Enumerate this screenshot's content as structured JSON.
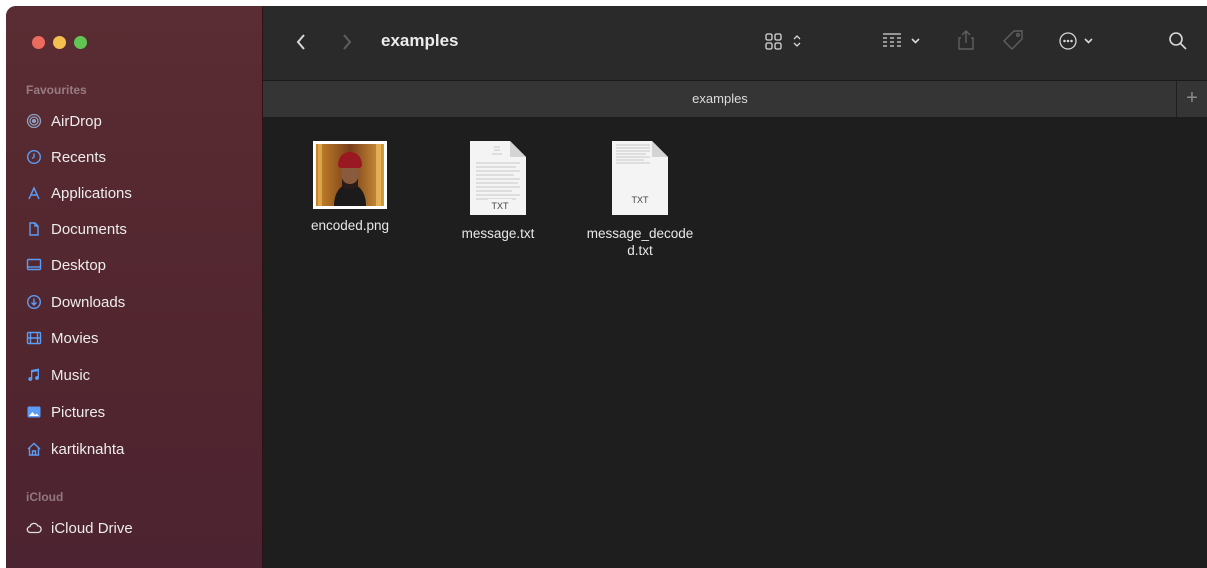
{
  "window": {
    "title": "examples"
  },
  "sidebar": {
    "sections": [
      {
        "label": "Favourites",
        "items": [
          {
            "label": "AirDrop",
            "icon": "airdrop-icon"
          },
          {
            "label": "Recents",
            "icon": "clock-icon"
          },
          {
            "label": "Applications",
            "icon": "applications-icon"
          },
          {
            "label": "Documents",
            "icon": "document-icon"
          },
          {
            "label": "Desktop",
            "icon": "desktop-icon"
          },
          {
            "label": "Downloads",
            "icon": "download-icon"
          },
          {
            "label": "Movies",
            "icon": "film-icon"
          },
          {
            "label": "Music",
            "icon": "music-note-icon"
          },
          {
            "label": "Pictures",
            "icon": "photo-icon"
          },
          {
            "label": "kartiknahta",
            "icon": "home-icon"
          }
        ]
      },
      {
        "label": "iCloud",
        "items": [
          {
            "label": "iCloud Drive",
            "icon": "cloud-icon"
          }
        ]
      }
    ]
  },
  "toolbar": {
    "title": "examples",
    "icons": [
      "back-chevron-icon",
      "forward-chevron-icon",
      "icon-view-icon",
      "group-icon",
      "share-icon",
      "tag-icon",
      "more-icon",
      "search-icon"
    ]
  },
  "tabbar": {
    "tab_title": "examples",
    "plus": "+"
  },
  "files": [
    {
      "name": "encoded.png",
      "kind": "image"
    },
    {
      "name": "message.txt",
      "kind": "text",
      "badge": "TXT"
    },
    {
      "name": "message_decoded.txt",
      "kind": "text",
      "badge": "TXT"
    }
  ],
  "colors": {
    "accent": "#4a8cf7",
    "sidebar": "#52262f",
    "window": "#1e1e1e"
  }
}
